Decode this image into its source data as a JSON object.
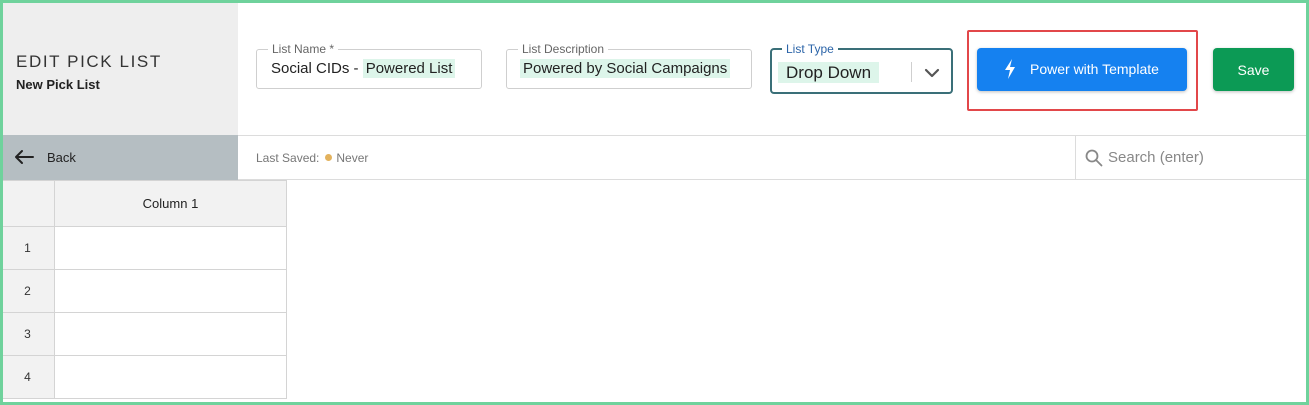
{
  "header": {
    "title": "EDIT PICK LIST",
    "subtitle": "New Pick List",
    "list_name": {
      "label": "List Name *",
      "value_prefix": "Social CIDs - ",
      "value_highlight": "Powered List"
    },
    "list_description": {
      "label": "List Description",
      "value_highlight": "Powered by Social Campaigns"
    },
    "list_type": {
      "label": "List Type",
      "selected": "Drop Down"
    },
    "template_button": "Power with Template",
    "save_button": "Save"
  },
  "toolbar": {
    "back_label": "Back",
    "last_saved_label": "Last Saved:",
    "last_saved_value": "Never",
    "search_placeholder": "Search (enter)"
  },
  "grid": {
    "columns": [
      "Column 1"
    ],
    "rows": [
      "1",
      "2",
      "3",
      "4"
    ]
  },
  "colors": {
    "frame": "#6fd29c",
    "callout": "#e2474a",
    "primary_button": "#1581f0",
    "save_button": "#0c9a55",
    "highlight": "#ddf5ea",
    "status_dot": "#e3b25d"
  },
  "icons": [
    "lightning-bolt-icon",
    "chevron-down-icon",
    "arrow-left-icon",
    "search-icon"
  ]
}
